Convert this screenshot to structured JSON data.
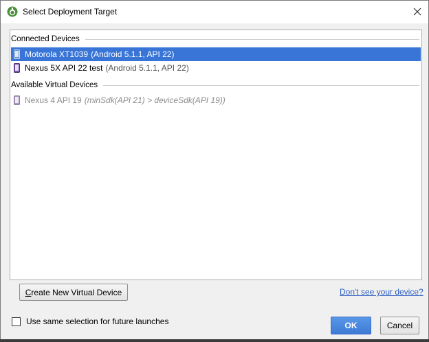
{
  "window": {
    "title": "Select Deployment Target"
  },
  "sections": {
    "connected": {
      "label": "Connected Devices",
      "devices": [
        {
          "name": "Motorola XT1039",
          "detail": "(Android 5.1.1, API 22)",
          "selected": true
        },
        {
          "name": "Nexus 5X API 22 test",
          "detail": "(Android 5.1.1, API 22)",
          "selected": false
        }
      ]
    },
    "available": {
      "label": "Available Virtual Devices",
      "devices": [
        {
          "name": "Nexus 4 API 19",
          "detail": "(minSdk(API 21) > deviceSdk(API 19))",
          "disabled": true
        }
      ]
    }
  },
  "actions": {
    "create_virtual_device_prefix": "C",
    "create_virtual_device_rest": "reate New Virtual Device",
    "help_link": "Don't see your device?",
    "same_selection_label": "Use same selection for future launches",
    "same_selection_checked": false,
    "ok_label": "OK",
    "cancel_label": "Cancel"
  },
  "colors": {
    "selection": "#3875d7",
    "link": "#2f5fc4",
    "primary_button": "#3d7bd6"
  },
  "icons": {
    "app": "android-studio-icon",
    "close": "close-icon",
    "device": "phone-icon"
  }
}
